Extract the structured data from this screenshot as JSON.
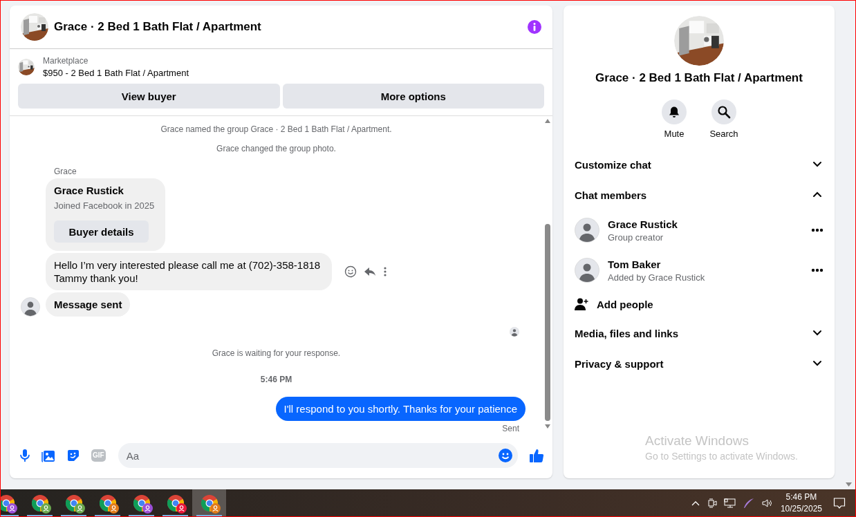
{
  "conversation": {
    "title": "Grace · 2 Bed 1 Bath Flat / Apartment",
    "listing": {
      "label": "Marketplace",
      "text": "$950 - 2 Bed 1 Bath Flat / Apartment"
    },
    "actions": [
      "View buyer",
      "More options"
    ],
    "messages": [
      {
        "kind": "notice",
        "text": "Grace named the group Grace · 2 Bed 1 Bath Flat / Apartment."
      },
      {
        "kind": "notice",
        "text": "Grace changed the group photo."
      },
      {
        "kind": "sender",
        "text": "Grace"
      },
      {
        "kind": "profile",
        "name": "Grace Rustick",
        "subtitle": "Joined Facebook in 2025",
        "button": "Buyer details"
      },
      {
        "kind": "incoming",
        "text": "Hello I’m very interested please call me at (702)-358-1818 Tammy thank you!",
        "bold": false,
        "avatar": false,
        "hover_actions": true
      },
      {
        "kind": "incoming",
        "text": "Message sent",
        "bold": true,
        "avatar": true,
        "hover_actions": false
      },
      {
        "kind": "read_receipt"
      },
      {
        "kind": "notice",
        "text": "Grace is waiting for your response."
      },
      {
        "kind": "time",
        "text": "5:46 PM"
      },
      {
        "kind": "outgoing",
        "text": "I'll respond to you shortly. Thanks for your patience",
        "status": "Sent"
      }
    ],
    "composer": {
      "gif": "GIF",
      "placeholder": "Aa"
    }
  },
  "details": {
    "title": "Grace · 2 Bed 1 Bath Flat / Apartment",
    "actions": [
      {
        "kind": "mute",
        "label": "Mute"
      },
      {
        "kind": "search",
        "label": "Search"
      }
    ],
    "sections": [
      {
        "kind": "section",
        "label": "Customize chat",
        "expanded": false
      },
      {
        "kind": "section",
        "label": "Chat members",
        "expanded": true
      },
      {
        "kind": "member",
        "name": "Grace Rustick",
        "subtitle": "Group creator"
      },
      {
        "kind": "member",
        "name": "Tom Baker",
        "subtitle": "Added by Grace Rustick"
      },
      {
        "kind": "add",
        "label": "Add people"
      },
      {
        "kind": "section",
        "label": "Media, files and links",
        "expanded": false
      },
      {
        "kind": "section",
        "label": "Privacy & support",
        "expanded": false
      }
    ]
  },
  "activation": {
    "title": "Activate Windows",
    "text": "Go to Settings to activate Windows."
  },
  "taskbar": {
    "apps": [
      {
        "color": "#9b4fd6",
        "selected": false
      },
      {
        "color": "#6aa84f",
        "selected": false
      },
      {
        "color": "#6aa84f",
        "selected": false
      },
      {
        "color": "#e07b1a",
        "selected": false
      },
      {
        "color": "#9b4fd6",
        "selected": false
      },
      {
        "color": "#e8173a",
        "selected": false
      },
      {
        "color": "#e07b1a",
        "selected": true
      }
    ],
    "time": "5:46 PM",
    "date": "10/25/2025"
  }
}
